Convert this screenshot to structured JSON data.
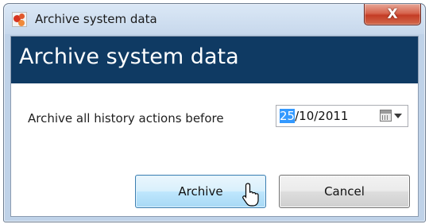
{
  "window": {
    "title": "Archive system data",
    "close_symbol": "X",
    "icon": "app-icon"
  },
  "banner": {
    "title": "Archive system data",
    "color": "#0f3a63"
  },
  "form": {
    "label": "Archive all history actions before",
    "date_selected_part": "25",
    "date_rest": "/10/2011",
    "calendar_icon": "calendar-icon",
    "dropdown_icon": "chevron-down-icon"
  },
  "buttons": {
    "archive": "Archive",
    "cancel": "Cancel"
  },
  "cursor": {
    "icon": "pointer-cursor-icon"
  }
}
